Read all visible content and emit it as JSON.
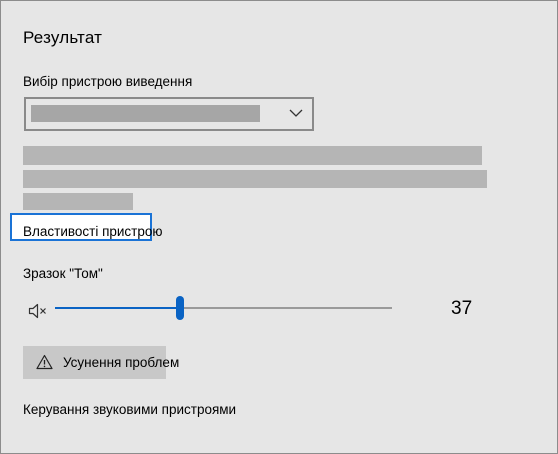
{
  "section": {
    "title": "Результат"
  },
  "device": {
    "label": "Вибір пристрою виведення",
    "selected_value": "",
    "dropdown_icon": "chevron-down-icon"
  },
  "device_properties": {
    "link_label": "Властивості пристрою"
  },
  "volume": {
    "label": "Зразок \"Том\"",
    "value": 37,
    "value_text": "37",
    "mute_icon": "speaker-muted-icon",
    "accent_color": "#0a63c4"
  },
  "troubleshoot": {
    "label": "Усунення проблем",
    "icon": "warning-icon"
  },
  "manage": {
    "link_label": "Керування звуковими пристроями"
  },
  "colors": {
    "panel_bg": "#e6e6e6",
    "focus_border": "#1a73d6",
    "accent": "#0a63c4"
  }
}
